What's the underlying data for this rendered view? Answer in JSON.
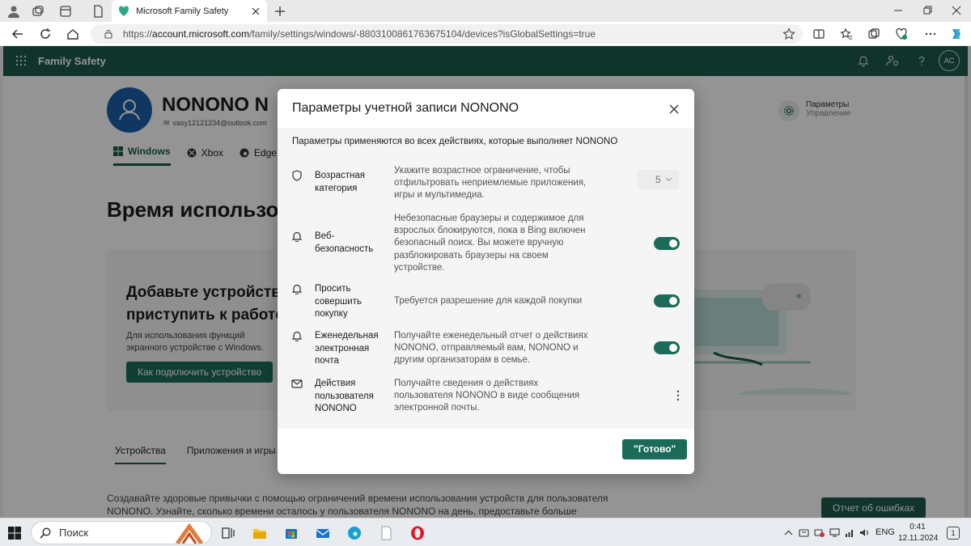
{
  "browser": {
    "tab_title": "Microsoft Family Safety",
    "url_prefix": "https://",
    "url_domain": "account.microsoft.com",
    "url_path": "/family/settings/windows/-8803100861763675104/devices?isGlobalSettings=true"
  },
  "app": {
    "title": "Family Safety",
    "avatar_initials": "AC"
  },
  "profile": {
    "name": "NONONO N",
    "email": "vasy12121234@outlook.com",
    "tabs": [
      "Windows",
      "Xbox",
      "Edge"
    ],
    "settings_label": "Параметры",
    "settings_sub": "Управление"
  },
  "page": {
    "section_title": "Время использова",
    "card_heading": "Добавьте устройства, приступить к работе",
    "card_text": "Для использования функций экранного устройстве с Windows.",
    "card_button": "Как подключить устройство",
    "bottom_tabs": [
      "Устройства",
      "Приложения и игры"
    ],
    "bottom_text": "Создавайте здоровые привычки с помощью ограничений времени использования устройств для пользователя NONONO. Узнайте, сколько времени осталось у пользователя NONONO на день, предоставьте больше времени или",
    "report_button": "Отчет об ошибках"
  },
  "modal": {
    "title": "Параметры учетной записи NONONO",
    "description": "Параметры применяются во всех действиях, которые выполняет NONONO",
    "rows": [
      {
        "label": "Возрастная категория",
        "desc": "Укажите возрастное ограничение, чтобы отфильтровать неприемлемые приложения, игры и мультимедиа.",
        "control": "select",
        "value": "5",
        "icon": "shield-icon"
      },
      {
        "label": "Веб-безопасность",
        "desc": "Небезопасные браузеры и содержимое для взрослых блокируются, пока в Bing включен безопасный поиск. Вы можете вручную разблокировать браузеры на своем устройстве.",
        "control": "toggle",
        "on": true,
        "icon": "bell-icon"
      },
      {
        "label": "Просить совершить покупку",
        "desc": "Требуется разрешение для каждой покупки",
        "control": "toggle",
        "on": true,
        "icon": "bell-icon"
      },
      {
        "label": "Еженедельная электронная почта",
        "desc": "Получайте еженедельный отчет о действиях NONONO, отправляемый вам, NONONO и другим организаторам в семье.",
        "control": "toggle",
        "on": true,
        "icon": "bell-icon"
      },
      {
        "label": "Действия пользователя NONONO",
        "desc": "Получайте сведения о действиях пользователя NONONO в виде сообщения электронной почты.",
        "control": "menu",
        "icon": "mail-icon"
      }
    ],
    "done_button": "\"Готово\""
  },
  "taskbar": {
    "search_placeholder": "Поиск",
    "lang": "ENG",
    "time": "0:41",
    "date": "12.11.2024",
    "notification_count": "1"
  },
  "colors": {
    "brand": "#1c5a4b",
    "toggle_on": "#1c6b5a",
    "avatar": "#1a5fa8"
  }
}
